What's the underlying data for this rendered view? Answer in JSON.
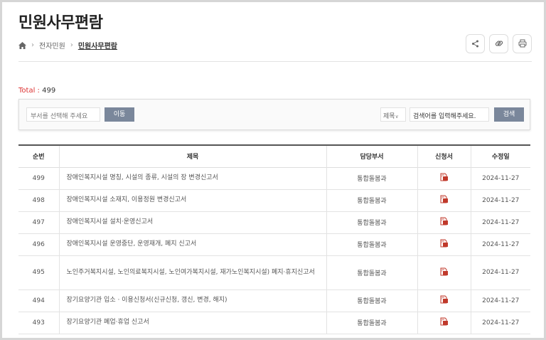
{
  "page": {
    "title": "민원사무편람"
  },
  "breadcrumb": {
    "home_icon": "home-icon",
    "items": [
      "전자민원",
      "민원사무편람"
    ]
  },
  "tools": {
    "icons": [
      "share-icon",
      "link-icon",
      "print-icon"
    ]
  },
  "total": {
    "label": "Total",
    "separator": " : ",
    "count": "499"
  },
  "search": {
    "dept_placeholder": "부서를 선택해 주세요",
    "move_label": "이동",
    "field_value": "제목",
    "keyword_placeholder": "검색어를 입력해주세요.",
    "search_label": "검색"
  },
  "table": {
    "headers": [
      "순번",
      "제목",
      "담당부서",
      "신청서",
      "수정일"
    ],
    "rows": [
      {
        "no": "499",
        "title": "장애인복지시설 명칭, 시설의 종류, 시설의 장 변경신고서",
        "dept": "통합돌봄과",
        "date": "2024-11-27"
      },
      {
        "no": "498",
        "title": "장애인복지시설 소재지, 이용정원 변경신고서",
        "dept": "통합돌봄과",
        "date": "2024-11-27"
      },
      {
        "no": "497",
        "title": "장애인복지시설 설치·운영신고서",
        "dept": "통합돌봄과",
        "date": "2024-11-27"
      },
      {
        "no": "496",
        "title": "장애인복지시설 운영중단, 운영재개, 폐지 신고서",
        "dept": "통합돌봄과",
        "date": "2024-11-27"
      },
      {
        "no": "495",
        "title": "노인주거복지시설, 노인의료복지시설, 노인여가복지시설, 재가노인복지시설) 폐지·휴지신고서",
        "dept": "통합돌봄과",
        "date": "2024-11-27"
      },
      {
        "no": "494",
        "title": "장기요양기관 입소 · 이용신청서(신규신청, 갱신, 변경, 해지)",
        "dept": "통합돌봄과",
        "date": "2024-11-27"
      },
      {
        "no": "493",
        "title": "장기요양기관 폐업·휴업 신고서",
        "dept": "통합돌봄과",
        "date": "2024-11-27"
      }
    ],
    "form_icon": "document-download-icon"
  },
  "colors": {
    "accent": "#7a879b",
    "total_label": "#d33333",
    "form_icon": "#c0392b"
  }
}
